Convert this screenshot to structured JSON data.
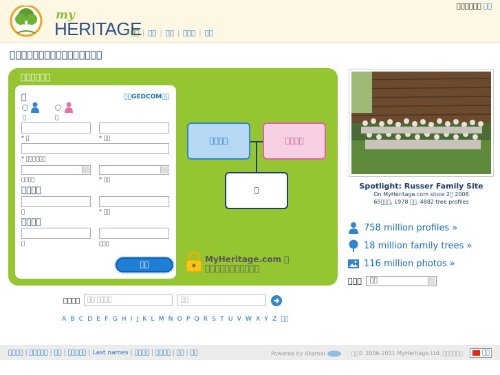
{
  "header": {
    "logo_my": "my",
    "logo_heritage": "HERITAGE",
    "nav": [
      "\u0000\u0000",
      "\u0000\u0000",
      "\u0000\u0000",
      "\u0000\u0000\u0000",
      "\u0000\u0000"
    ],
    "lang_text": "\u0000\u0000\u0000\u0000\u0000\u0000",
    "lang_link": "\u0000\u0000"
  },
  "page_title": "\u0000\u0000\u0000\u0000\u0000\u0000\u0000\u0000\u0000\u0000\u0000\u0000\u0000\u0000\u0000\u0000",
  "panel": {
    "title": "\u0000\u0000\u0000\u0000\u0000\u0000",
    "me_heading": "\u0000",
    "gedcom": "\u0000\u0000GEDCOM\u0000\u0000",
    "gender_male": "\u0000",
    "gender_female": "\u0000",
    "first_name": "* \u0000",
    "last_name": "* \u0000\u0000",
    "email": "* \u0000\u0000\u0000\u0000\u0000\u0000",
    "birth": "\u0000\u0000\u0000\u0000",
    "country": "* \u0000\u0000",
    "father_heading": "\u0000\u0000\u0000\u0000",
    "father_first": "\u0000",
    "father_last": "* \u0000\u0000",
    "mother_heading": "\u0000\u0000\u0000\u0000",
    "mother_first": "\u0000",
    "mother_last": "\u0000\u0000\u0000",
    "start_button": "\u0000\u0000",
    "tree_father": "\u0000\u0000\u0000\u0000",
    "tree_mother": "\u0000\u0000\u0000\u0000",
    "tree_me": "\u0000",
    "lock_line1": "MyHeritage.com \u0000",
    "lock_line2": "\u0000\u0000\u0000\u0000\u0000\u0000\u0000\u0000\u0000\u0000\u0000"
  },
  "spotlight": {
    "title": "Spotlight: Russer Family Site",
    "line1": "On MyHeritage.com since 2\u0000 2008",
    "line2": "65\u0000\u0000\u0000, 1978 \u0000\u0000, 4882 tree profiles"
  },
  "stats": [
    {
      "label": "758 million profiles »",
      "icon": "person-icon"
    },
    {
      "label": "18 million family trees »",
      "icon": "tree-icon"
    },
    {
      "label": "116 million photos »",
      "icon": "photo-icon"
    }
  ],
  "language_select": {
    "label": "\u0000\u0000\u0000",
    "value": "\u0000\u0000"
  },
  "search": {
    "label": "\u0000\u0000\u0000\u0000",
    "first_placeholder": "\u0000\u0000 \u0000\u0000\u0000\u0000",
    "last_placeholder": "\u0000\u0000"
  },
  "alphabet": [
    "A",
    "B",
    "C",
    "D",
    "E",
    "F",
    "G",
    "H",
    "I",
    "J",
    "K",
    "L",
    "M",
    "N",
    "O",
    "P",
    "Q",
    "R",
    "S",
    "T",
    "U",
    "V",
    "W",
    "X",
    "Y",
    "Z",
    "\u0000\u0000"
  ],
  "footer": {
    "links": [
      "\u0000\u0000\u0000\u0000",
      "\u0000\u0000\u0000\u0000\u0000",
      "\u0000\u0000",
      "\u0000\u0000\u0000\u0000\u0000",
      "Last names",
      "\u0000\u0000\u0000\u0000",
      "\u0000\u0000\u0000\u0000",
      "\u0000\u0000",
      "\u0000\u0000"
    ],
    "akamai": "Powered by Akamai",
    "copyright": "\u0000\u0000© 2006-2011 MyHeritage Ltd.,\u0000\u0000\u0000\u0000\u0000\u0000",
    "lang": "\u0000\u0000"
  },
  "colors": {
    "panel_green": "#96c532",
    "brand_blue": "#2a5389",
    "link_blue": "#1a6ec2"
  }
}
